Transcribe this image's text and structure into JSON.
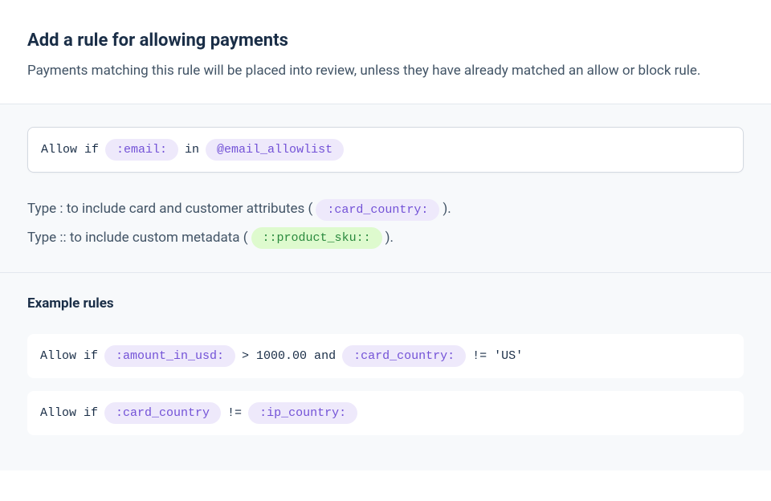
{
  "header": {
    "title": "Add a rule for allowing payments",
    "subtitle": "Payments matching this rule will be placed into review, unless they have already matched an allow or block rule."
  },
  "rule_input": {
    "prefix": "Allow if",
    "token_email": ":email:",
    "keyword_in": "in",
    "token_allowlist": "@email_allowlist"
  },
  "help": {
    "line1_prefix": "Type : to include card and customer attributes (",
    "line1_token": ":card_country:",
    "line1_suffix": ").",
    "line2_prefix": "Type :: to include custom metadata (",
    "line2_token": "::product_sku::",
    "line2_suffix": ")."
  },
  "examples": {
    "title": "Example rules",
    "rule1": {
      "prefix": "Allow if",
      "token1": ":amount_in_usd:",
      "op1": "> 1000.00 and",
      "token2": ":card_country:",
      "op2": "!= 'US'"
    },
    "rule2": {
      "prefix": "Allow if",
      "token1": ":card_country",
      "op1": "!=",
      "token2": ":ip_country:"
    }
  }
}
